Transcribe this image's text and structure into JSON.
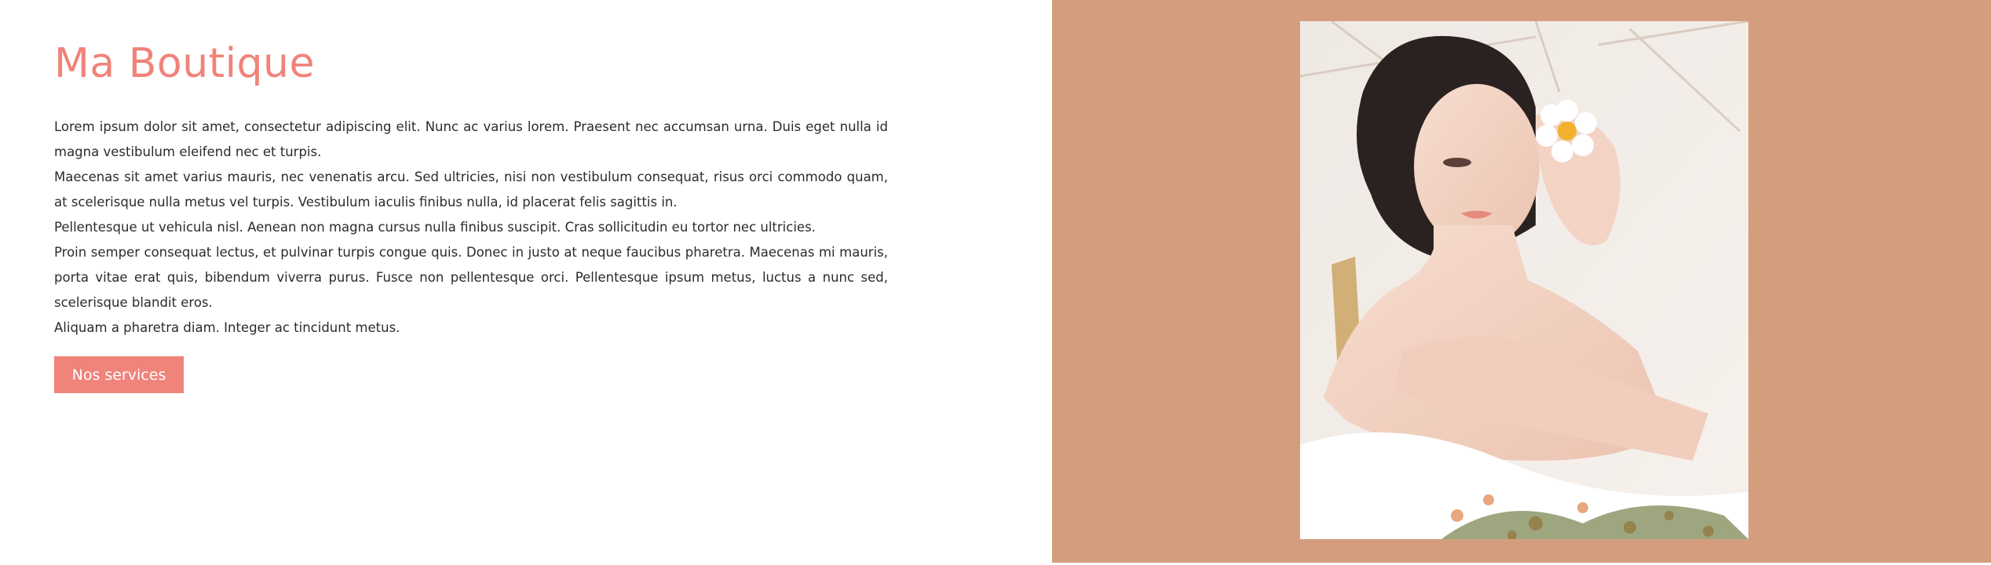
{
  "hero": {
    "title": "Ma Boutique",
    "paragraphs": [
      "Lorem ipsum dolor sit amet, consectetur adipiscing elit. Nunc ac varius lorem. Praesent nec accumsan urna. Duis eget nulla id magna vestibulum eleifend nec et turpis.",
      "Maecenas sit amet varius mauris, nec venenatis arcu. Sed ultricies, nisi non vestibulum consequat, risus orci commodo quam, at scelerisque nulla metus vel turpis. Vestibulum iaculis finibus nulla, id placerat felis sagittis in.",
      "Pellentesque ut vehicula nisl. Aenean non magna cursus nulla finibus suscipit. Cras sollicitudin eu tortor nec ultricies.",
      "Proin semper consequat lectus, et pulvinar turpis congue quis. Donec in justo at neque faucibus pharetra. Maecenas mi mauris, porta vitae erat quis, bibendum viverra purus. Fusce non pellentesque orci. Pellentesque ipsum metus, luctus a nunc sed, scelerisque blandit eros.",
      "Aliquam a pharetra diam. Integer ac tincidunt metus."
    ],
    "cta_label": "Nos services"
  },
  "colors": {
    "accent": "#f0837a",
    "panel": "#d49e7e",
    "text": "#2b2b2b"
  }
}
